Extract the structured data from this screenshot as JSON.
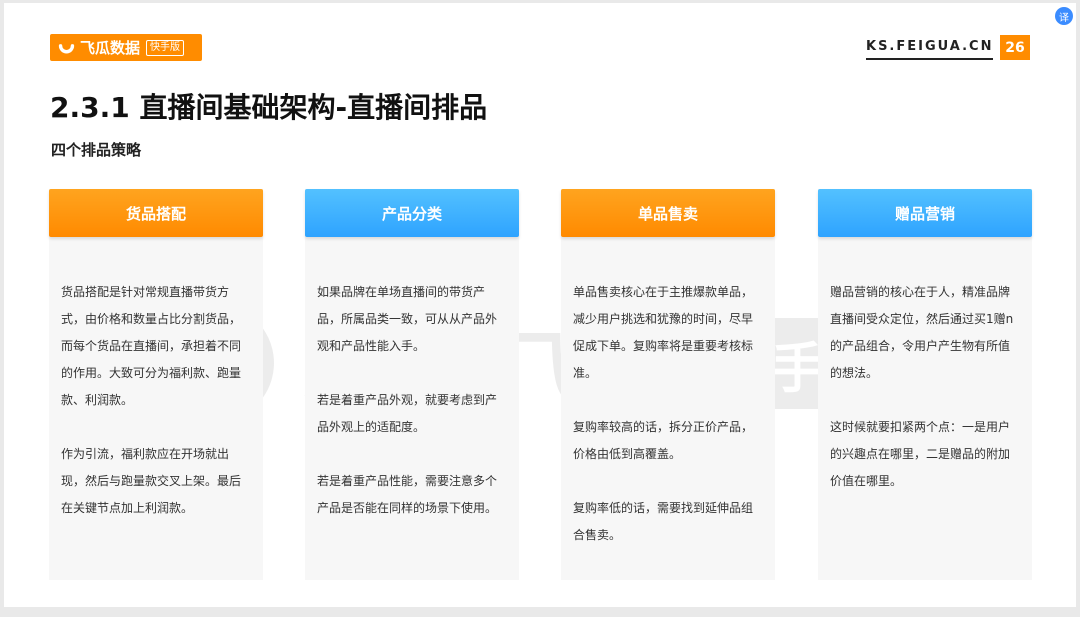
{
  "header": {
    "logo_text": "飞瓜数据",
    "logo_badge": "快手版",
    "site": "KS.FEIGUA.CN",
    "page_number": "26"
  },
  "title": "2.3.1 直播间基础架构-直播间排品",
  "subtitle": "四个排品策略",
  "colors": {
    "orange": "#ff8c00",
    "blue": "#2ea3ff"
  },
  "cards": [
    {
      "title": "货品搭配",
      "paragraphs": [
        "货品搭配是针对常规直播带货方式，由价格和数量占比分割货品，而每个货品在直播间，承担着不同的作用。大致可分为福利款、跑量款、利润款。",
        "作为引流，福利款应在开场就出现，然后与跑量款交叉上架。最后在关键节点加上利润款。"
      ]
    },
    {
      "title": "产品分类",
      "paragraphs": [
        "如果品牌在单场直播间的带货产品，所属品类一致，可从从产品外观和产品性能入手。",
        "若是着重产品外观，就要考虑到产品外观上的适配度。",
        "若是着重产品性能，需要注意多个产品是否能在同样的场景下使用。"
      ]
    },
    {
      "title": "单品售卖",
      "paragraphs": [
        "单品售卖核心在于主推爆款单品，减少用户挑选和犹豫的时间，尽早促成下单。复购率将是重要考核标准。",
        "复购率较高的话，拆分正价产品，价格由低到高覆盖。",
        "复购率低的话，需要找到延伸品组合售卖。"
      ]
    },
    {
      "title": "赠品营销",
      "paragraphs": [
        "赠品营销的核心在于人，精准品牌直播间受众定位，然后通过买1赠n的产品组合，令用户产生物有所值的想法。",
        "这时候就要扣紧两个点：一是用户的兴趣点在哪里，二是赠品的附加价值在哪里。"
      ]
    }
  ]
}
